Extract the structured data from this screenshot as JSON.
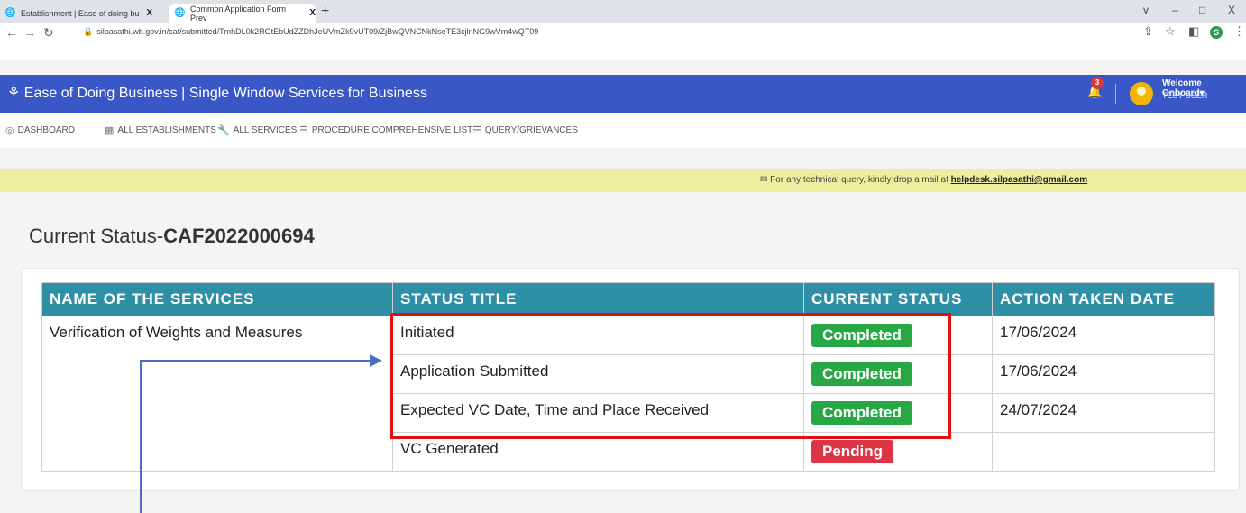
{
  "browser": {
    "tabs": [
      {
        "title": "Establishment | Ease of doing bu",
        "close": "X"
      },
      {
        "title": "Common Application Form Prev",
        "close": "X"
      }
    ],
    "new_tab": "+",
    "window_controls": [
      "v",
      "–",
      "□",
      "X"
    ],
    "url": "silpasathi.wb.gov.in/caf/submitted/TmhDL0k2RGtEbUdZZDhJeUVmZk9vUT09/ZjBwQVNCNkNseTE3cjlnNG9wVm4wQT09",
    "profile_initial": "S"
  },
  "header": {
    "brand": "Ease of Doing Business | Single Window Services for Business",
    "notification_count": "3",
    "welcome": "Welcome Onboard",
    "user": "TEST USER"
  },
  "nav": {
    "items": [
      "DASHBOARD",
      "ALL ESTABLISHMENTS",
      "ALL SERVICES",
      "PROCEDURE COMPREHENSIVE LIST",
      "QUERY/GRIEVANCES"
    ]
  },
  "notice": {
    "text": "For any technical query, kindly drop a mail at ",
    "email": "helpdesk.silpasathi@gmail.com"
  },
  "page": {
    "status_prefix": "Current Status-",
    "caf_id": "CAF2022000694"
  },
  "table": {
    "headers": [
      "NAME OF THE SERVICES",
      "STATUS TITLE",
      "CURRENT STATUS",
      "ACTION TAKEN DATE"
    ],
    "service_name": "Verification of Weights and Measures",
    "rows": [
      {
        "title": "Initiated",
        "status": "Completed",
        "date": "17/06/2024"
      },
      {
        "title": "Application Submitted",
        "status": "Completed",
        "date": "17/06/2024"
      },
      {
        "title": "Expected VC Date, Time and Place Received",
        "status": "Completed",
        "date": "24/07/2024"
      },
      {
        "title": "VC Generated",
        "status": "Pending",
        "date": ""
      }
    ]
  },
  "colors": {
    "header_bg": "#3a57c8",
    "table_header_bg": "#2e90a6",
    "completed": "#28a745",
    "pending": "#dc3545",
    "highlight_box": "#e01010",
    "notice_bg": "#eeee9f"
  }
}
